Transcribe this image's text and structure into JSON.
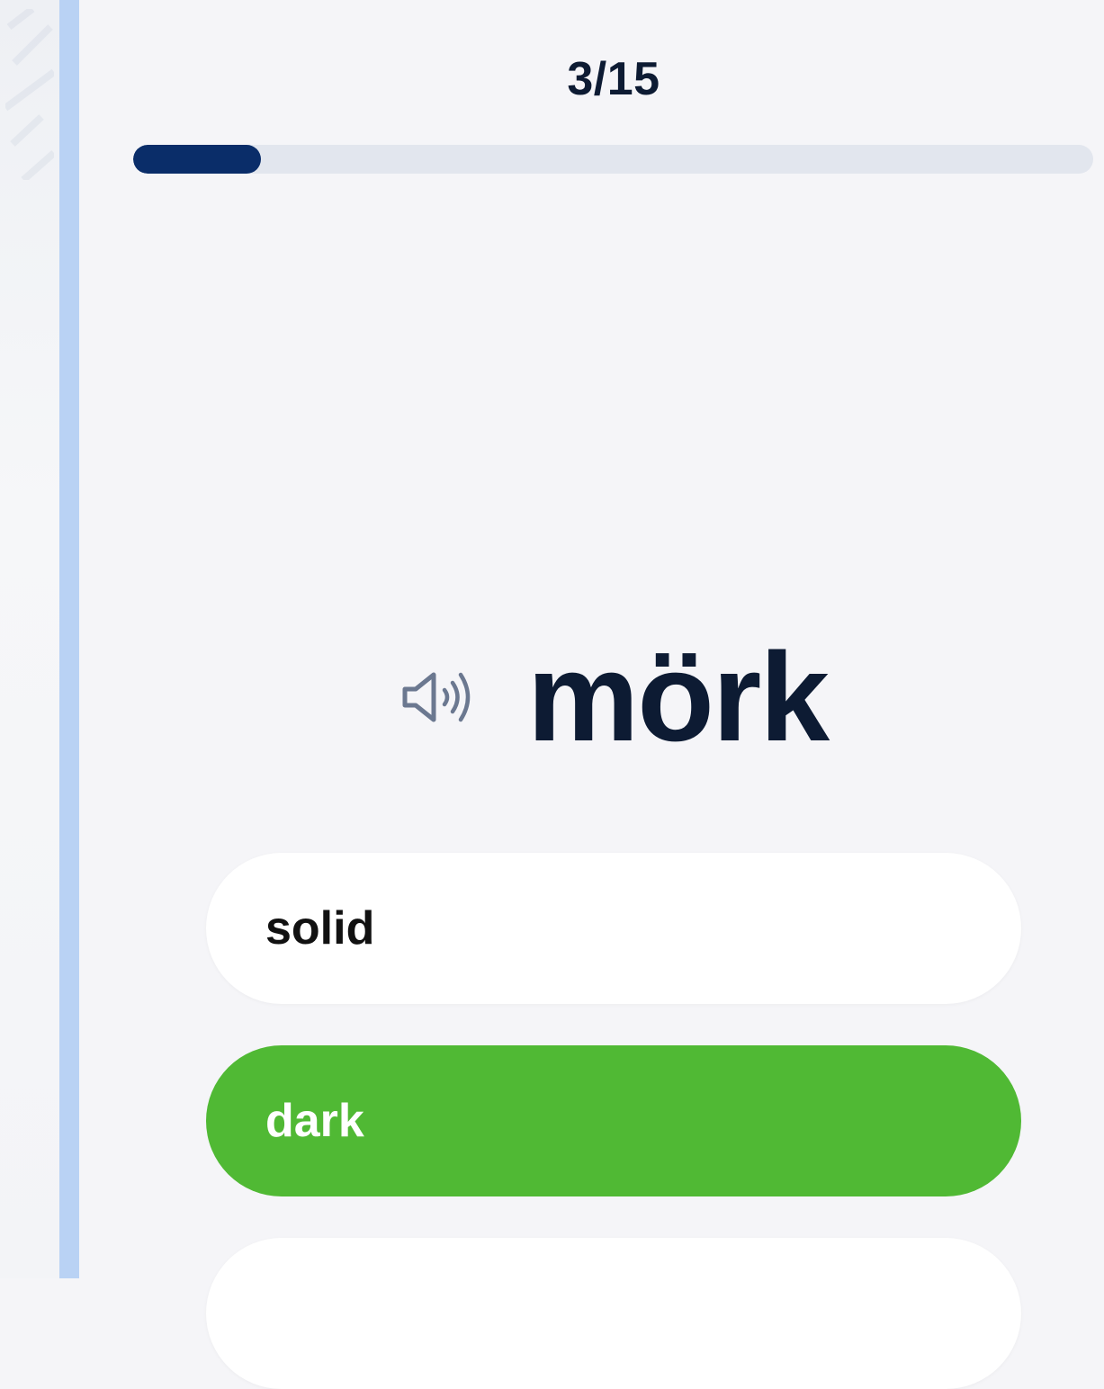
{
  "progress": {
    "counter": "3/15",
    "fraction": 0.133,
    "fill_color": "#0a2d69",
    "track_color": "#e2e6ee"
  },
  "question": {
    "word": "mörk",
    "audio_icon": "speaker-icon"
  },
  "options": [
    {
      "label": "solid",
      "state": "default"
    },
    {
      "label": "dark",
      "state": "correct",
      "color": "#50b934"
    },
    {
      "label": "",
      "state": "default"
    }
  ],
  "colors": {
    "divider": "#b9d2f4",
    "text_primary": "#0d1b33",
    "correct": "#50b934"
  }
}
